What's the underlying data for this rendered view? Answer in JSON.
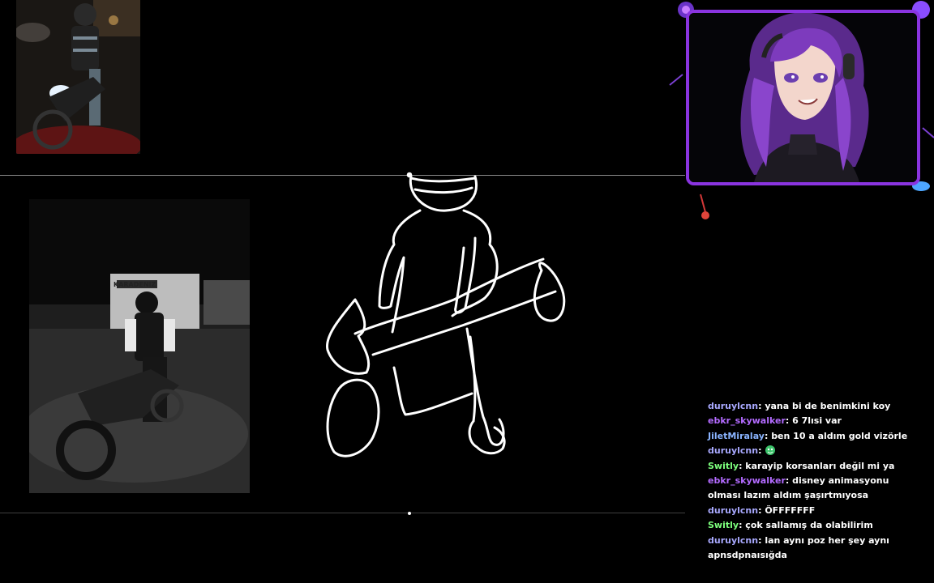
{
  "colors": {
    "background": "#000000",
    "webcam_border": "#8a34e0",
    "drawing_stroke": "#ffffff",
    "divider": "#8a8a8a"
  },
  "photos": {
    "top_thumbnail": {
      "subject": "motorcycle rider at night",
      "icon": "photo-icon"
    },
    "main_photo": {
      "subject": "motorcycle rider black and white",
      "sign_text": "KARADENIZ"
    }
  },
  "drawing": {
    "icon": "drawing-icon",
    "stroke_color": "#ffffff"
  },
  "webcam": {
    "avatar": "purple-haired anime vtuber avatar",
    "icon": "avatar-icon"
  },
  "chat": {
    "messages": [
      {
        "user": "duruylcnn",
        "color": "#a9a9ff",
        "text": "yana bi de benimkini koy"
      },
      {
        "user": "ebkr_skywalker",
        "color": "#b36bff",
        "text": "6 7lısi var"
      },
      {
        "user": "JiletMiralay",
        "color": "#8ab4ff",
        "text": "ben 10 a aldım gold vizörle"
      },
      {
        "user": "duruylcnn",
        "color": "#a9a9ff",
        "text": "",
        "emote": "green-emote-icon"
      },
      {
        "user": "Switly",
        "color": "#7dff7d",
        "text": "karayip korsanları değil mi ya"
      },
      {
        "user": "ebkr_skywalker",
        "color": "#b36bff",
        "text": "disney animasyonu olması lazım aldım şaşırtmıyosa"
      },
      {
        "user": "duruylcnn",
        "color": "#a9a9ff",
        "text": "ÖFFFFFFF"
      },
      {
        "user": "Switly",
        "color": "#7dff7d",
        "text": "çok sallamış da olabilirim"
      },
      {
        "user": "duruylcnn",
        "color": "#a9a9ff",
        "text": "lan aynı poz her şey aynı apnsdpnaısığda"
      }
    ]
  }
}
